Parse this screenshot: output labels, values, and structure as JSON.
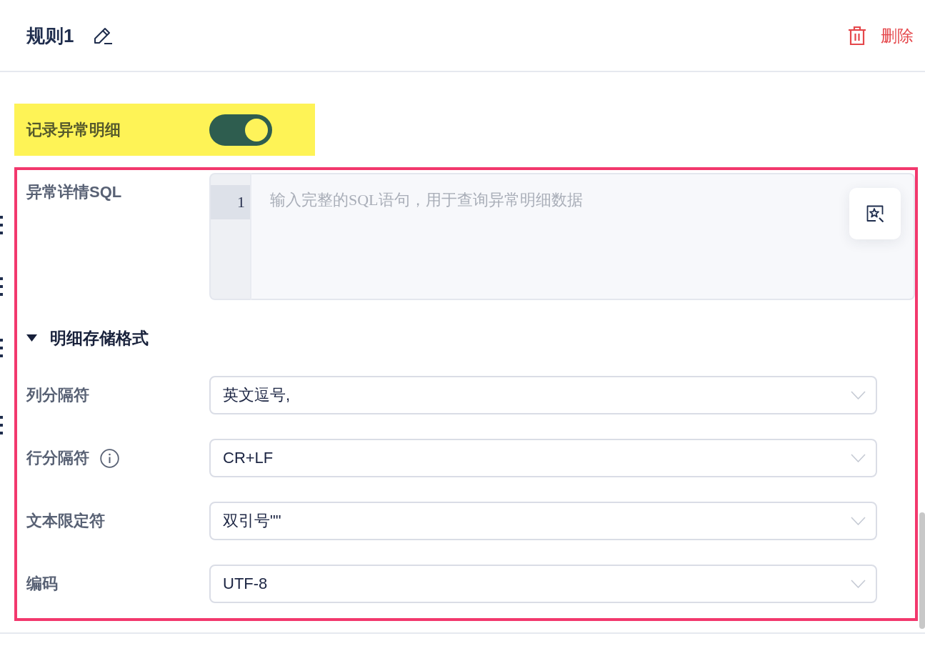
{
  "header": {
    "title": "规则1",
    "delete_label": "删除"
  },
  "detail_toggle": {
    "label": "记录异常明细",
    "on": true,
    "highlighted": true
  },
  "details": {
    "outlined": true,
    "sql": {
      "label": "异常详情SQL",
      "lines": [
        {
          "number": "1",
          "active": true
        }
      ],
      "placeholder": "输入完整的SQL语句，用于查询异常明细数据"
    },
    "storage_format": {
      "title": "明细存储格式",
      "expanded": true,
      "fields": [
        {
          "label": "列分隔符",
          "value": "英文逗号,",
          "info": false
        },
        {
          "label": "行分隔符",
          "value": "CR+LF",
          "info": true
        },
        {
          "label": "文本限定符",
          "value": "双引号\"\"",
          "info": false
        },
        {
          "label": "编码",
          "value": "UTF-8",
          "info": false
        }
      ]
    }
  }
}
